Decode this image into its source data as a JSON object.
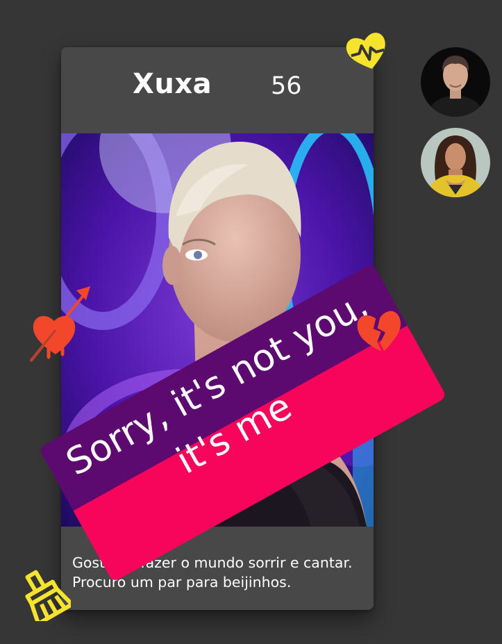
{
  "profile": {
    "name": "Xuxa",
    "age": "56",
    "bio": "Gosto de fazer o mundo sorrir e cantar. Procuro um par para beijinhos."
  },
  "banner": {
    "line1": "Sorry, it's not you,",
    "line2": "it's me",
    "colors": {
      "top": "#5c0a70",
      "bottom": "#f7055a"
    }
  },
  "icons": {
    "corner_heart": "heartbeat-heart-icon",
    "cupid": "heart-arrow-icon",
    "broken_heart": "broken-heart-icon",
    "broom": "broom-icon"
  },
  "matches": [
    {
      "icon": "avatar-man"
    },
    {
      "icon": "avatar-woman"
    }
  ],
  "colors": {
    "background": "#363636",
    "card": "#484848",
    "accent_yellow": "#f5e32e",
    "accent_red": "#f2472b"
  }
}
